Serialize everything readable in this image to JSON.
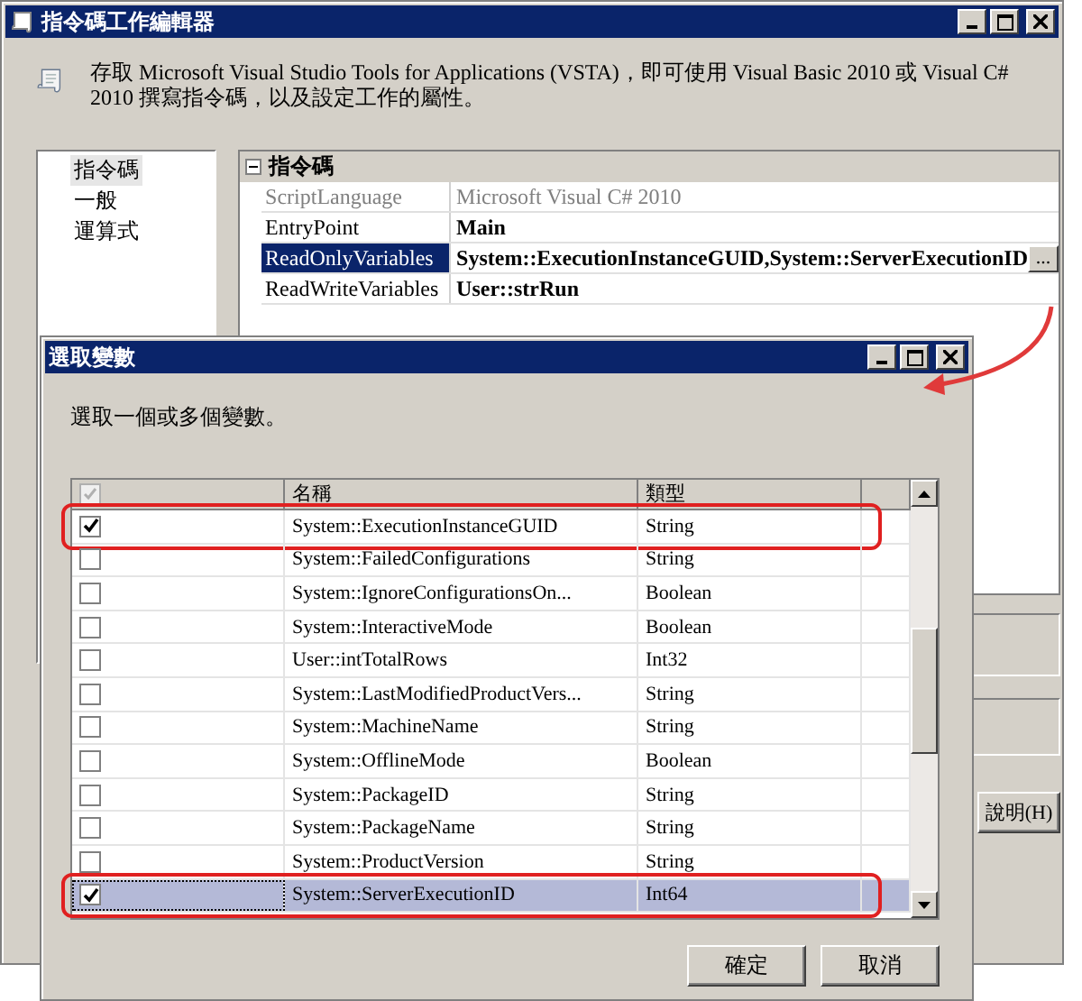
{
  "main_window": {
    "title": "指令碼工作編輯器",
    "description": "存取 Microsoft Visual Studio Tools for Applications (VSTA)，即可使用 Visual Basic 2010 或 Visual C# 2010 撰寫指令碼，以及設定工作的屬性。",
    "nav_items": [
      {
        "label": "指令碼",
        "selected": true
      },
      {
        "label": "一般",
        "selected": false
      },
      {
        "label": "運算式",
        "selected": false
      }
    ],
    "property_grid": {
      "category": "指令碼",
      "properties": [
        {
          "name": "ScriptLanguage",
          "value": "Microsoft Visual C# 2010",
          "disabled": true,
          "selected": false
        },
        {
          "name": "EntryPoint",
          "value": "Main",
          "disabled": false,
          "selected": false
        },
        {
          "name": "ReadOnlyVariables",
          "value": "System::ExecutionInstanceGUID,System::ServerExecutionID",
          "disabled": false,
          "selected": true,
          "button": "..."
        },
        {
          "name": "ReadWriteVariables",
          "value": "User::strRun",
          "disabled": false,
          "selected": false
        }
      ]
    },
    "help_button": "說明(H)"
  },
  "dialog": {
    "title": "選取變數",
    "prompt": "選取一個或多個變數。",
    "columns": [
      "名稱",
      "類型"
    ],
    "rows": [
      {
        "name": "System::ExecutionInstanceGUID",
        "type": "String",
        "checked": true,
        "selected": false,
        "annotated": true
      },
      {
        "name": "System::FailedConfigurations",
        "type": "String",
        "checked": false,
        "selected": false,
        "annotated": false
      },
      {
        "name": "System::IgnoreConfigurationsOn...",
        "type": "Boolean",
        "checked": false,
        "selected": false,
        "annotated": false
      },
      {
        "name": "System::InteractiveMode",
        "type": "Boolean",
        "checked": false,
        "selected": false,
        "annotated": false
      },
      {
        "name": "User::intTotalRows",
        "type": "Int32",
        "checked": false,
        "selected": false,
        "annotated": false
      },
      {
        "name": "System::LastModifiedProductVers...",
        "type": "String",
        "checked": false,
        "selected": false,
        "annotated": false
      },
      {
        "name": "System::MachineName",
        "type": "String",
        "checked": false,
        "selected": false,
        "annotated": false
      },
      {
        "name": "System::OfflineMode",
        "type": "Boolean",
        "checked": false,
        "selected": false,
        "annotated": false
      },
      {
        "name": "System::PackageID",
        "type": "String",
        "checked": false,
        "selected": false,
        "annotated": false
      },
      {
        "name": "System::PackageName",
        "type": "String",
        "checked": false,
        "selected": false,
        "annotated": false
      },
      {
        "name": "System::ProductVersion",
        "type": "String",
        "checked": false,
        "selected": false,
        "annotated": false
      },
      {
        "name": "System::ServerExecutionID",
        "type": "Int64",
        "checked": true,
        "selected": true,
        "annotated": true
      }
    ],
    "buttons": [
      "確定",
      "取消"
    ]
  }
}
